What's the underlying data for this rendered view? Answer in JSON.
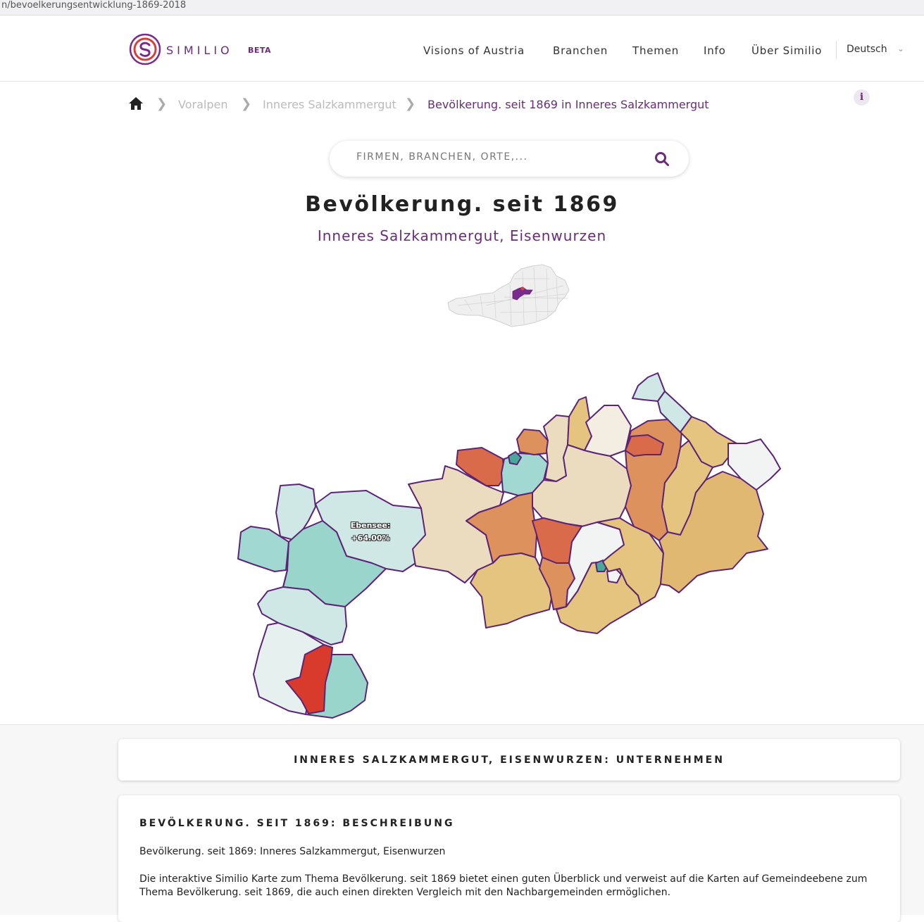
{
  "browser": {
    "url": "n/bevoelkerungsentwicklung-1869-2018"
  },
  "header": {
    "logo_text": "SIMILIO",
    "logo_beta": "BETA",
    "nav": [
      {
        "label": "Visions of Austria"
      },
      {
        "label": "Branchen"
      },
      {
        "label": "Themen"
      },
      {
        "label": "Info"
      },
      {
        "label": "Über Similio"
      }
    ],
    "language": "Deutsch"
  },
  "breadcrumb": {
    "items": [
      {
        "label": "Voralpen"
      },
      {
        "label": "Inneres Salzkammergut"
      },
      {
        "label": "Bevölkerung. seit 1869 in Inneres Salzkammergut"
      }
    ]
  },
  "info_button": "i",
  "search": {
    "placeholder": "FIRMEN, BRANCHEN, ORTE,..."
  },
  "page": {
    "title": "Bevölkerung. seit 1869",
    "subtitle": "Inneres Salzkammergut, Eisenwurzen"
  },
  "map": {
    "tooltip_name": "Ebensee:",
    "tooltip_value": "+64.00%",
    "border_color": "#5b2476",
    "highlight_color": "#7a2a8c",
    "palette": {
      "teal_light": "#cfe7e5",
      "teal": "#a2d8d2",
      "teal_mid": "#9ad5cc",
      "teal_dark": "#4aa89a",
      "pale": "#e6f0ef",
      "white": "#f2f4f4",
      "beige": "#ecdcbf",
      "sand": "#e4c47e",
      "gold": "#e0b872",
      "orange": "#dd915c",
      "redorange": "#d96a4a",
      "red": "#d83a2c"
    }
  },
  "cards": {
    "companies_title": "INNERES SALZKAMMERGUT, EISENWURZEN: UNTERNEHMEN",
    "description_title": "BEVÖLKERUNG. SEIT 1869: BESCHREIBUNG",
    "description_line1": "Bevölkerung. seit 1869: Inneres Salzkammergut, Eisenwurzen",
    "description_line2": "Die interaktive Similio Karte zum Thema Bevölkerung. seit 1869 bietet einen guten Überblick und verweist auf die Karten auf Gemeindeebene zum Thema Bevölkerung. seit 1869, die auch einen direkten Vergleich mit den Nachbargemeinden ermöglichen."
  }
}
